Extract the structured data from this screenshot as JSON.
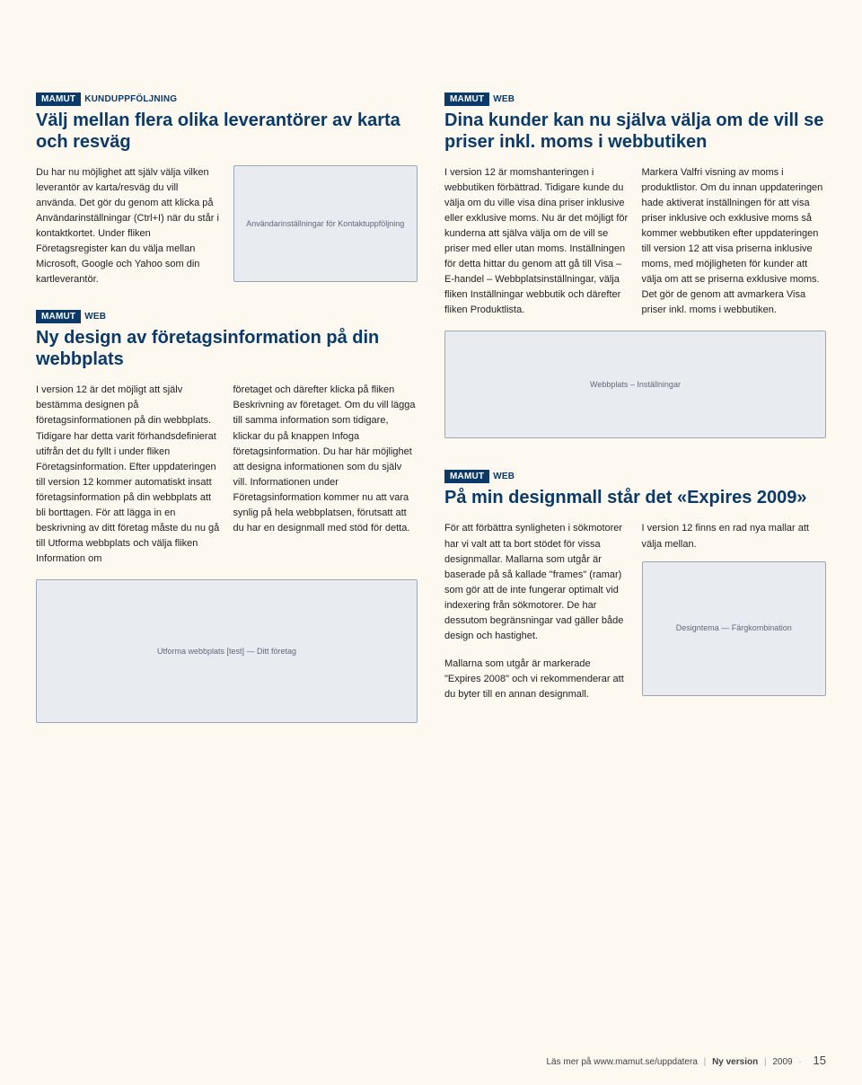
{
  "tags": {
    "brand": "MAMUT",
    "kund": "KUNDUPPFÖLJNING",
    "web": "WEB"
  },
  "leftTop": {
    "title": "Välj mellan flera olika leverantörer av karta och resväg",
    "body": "Du har nu möjlighet att själv välja vilken leverantör av karta/resväg du vill använda. Det gör du genom att klicka på Användarinställningar (Ctrl+I) när du står i kontaktkortet. Under fliken Företagsregister kan du välja mellan Microsoft, Google och Yahoo som din kartleverantör.",
    "shotLabel": "Användarinställningar för Kontaktuppföljning"
  },
  "leftBottom": {
    "title": "Ny design av företagsinformation på din webbplats",
    "col1": "I version 12 är det möjligt att själv bestämma designen på företagsinformationen på din webbplats. Tidigare har detta varit förhandsdefinierat utifrån det du fyllt i under fliken Företagsinformation. Efter uppdateringen till version 12 kommer automatiskt insatt företagsinformation på din webbplats att bli borttagen. För att lägga in en beskrivning av ditt företag måste du nu gå till Utforma webbplats och välja fliken Information om",
    "col2": "företaget och därefter klicka på fliken Beskrivning av företaget. Om du vill lägga till samma information som tidigare, klickar du på knappen Infoga företagsinformation. Du har här möjlighet att designa informationen som du själv vill. Informationen under Företagsinformation kommer nu att vara synlig på hela webbplatsen, förutsatt att du har en designmall med stöd för detta.",
    "shotLabel": "Utforma webbplats [test] — Ditt företag"
  },
  "rightTop": {
    "title": "Dina kunder kan nu själva välja om de vill se priser inkl. moms i webbutiken",
    "col1": "I version 12 är momshanteringen i webbutiken förbättrad. Tidigare kunde du välja om du ville visa dina priser inklusive eller exklusive moms. Nu är det möjligt för kunderna att själva välja om de vill se priser med eller utan moms. Inställningen för detta hittar du genom att gå till Visa – E-handel – Webbplatsinställningar, välja fliken Inställningar webbutik och därefter fliken Produktlista.",
    "col2": "Markera Valfri visning av moms i produktlistor. Om du innan uppdateringen hade aktiverat inställningen för att visa priser inklusive och exklusive moms så kommer webbutiken efter uppdateringen till version 12 att visa priserna inklusive moms, med möjligheten för kunder att välja om att se priserna exklusive moms. Det gör de genom att avmarkera Visa priser inkl. moms i webbutiken.",
    "shotLabel": "Webbplats – Inställningar"
  },
  "rightBottom": {
    "title": "På min designmall står det «Expires 2009»",
    "col1a": "För att förbättra synligheten i sökmotorer har vi valt att ta bort stödet för vissa designmallar. Mallarna som utgår är baserade på så kallade \"frames\" (ramar) som gör att de inte fungerar optimalt vid indexering från sökmotorer. De har dessutom begränsningar vad gäller både design och hastighet.",
    "col1b": "Mallarna som utgår är markerade \"Expires 2008\" och vi rekommenderar att du byter till en annan designmall.",
    "col2": "I version 12 finns en rad nya mallar att välja mellan.",
    "shotLabel": "Designtema — Färgkombination"
  },
  "footer": {
    "text": "Läs mer på www.mamut.se/uppdatera",
    "mid": "Ny version",
    "year": "2009",
    "page": "15"
  }
}
